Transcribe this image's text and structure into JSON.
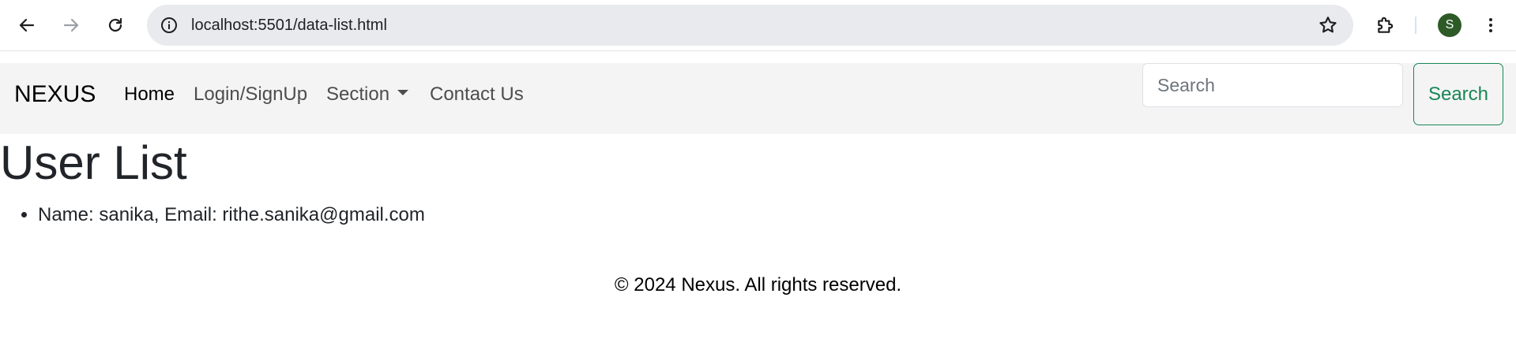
{
  "browser": {
    "url": "localhost:5501/data-list.html",
    "profile_initial": "S",
    "icons": {
      "back": "arrow-left-icon",
      "forward": "arrow-right-icon",
      "reload": "reload-icon",
      "site_info": "info-circle-icon",
      "bookmark": "star-outline-icon",
      "extensions": "puzzle-icon",
      "menu": "kebab-menu-icon"
    },
    "colors": {
      "avatar": "#2d5a27",
      "address_bar": "#e9eaee"
    }
  },
  "navbar": {
    "brand": "NEXUS",
    "links": [
      {
        "label": "Home",
        "active": true
      },
      {
        "label": "Login/SignUp",
        "active": false
      },
      {
        "label": "Section",
        "active": false,
        "dropdown": true
      },
      {
        "label": "Contact Us",
        "active": false
      }
    ],
    "search": {
      "placeholder": "Search",
      "value": "",
      "button_label": "Search"
    },
    "colors": {
      "background": "#f4f4f5",
      "search_button": "#198754"
    }
  },
  "main": {
    "title": "User List",
    "users": [
      "Name: sanika, Email: rithe.sanika@gmail.com"
    ]
  },
  "footer": {
    "text": "© 2024 Nexus. All rights reserved."
  }
}
